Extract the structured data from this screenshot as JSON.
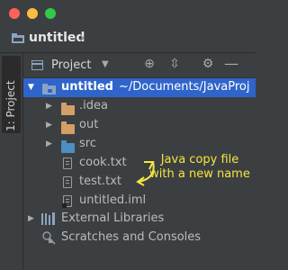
{
  "window": {
    "title": "untitled"
  },
  "sidebar": {
    "tab_label": "1: Project"
  },
  "panel": {
    "view_selector": "Project"
  },
  "tree": {
    "root_name": "untitled",
    "root_path": "~/Documents/JavaProj",
    "items": [
      {
        "label": ".idea",
        "kind": "folder",
        "color": "#d39f66"
      },
      {
        "label": "out",
        "kind": "folder",
        "color": "#d39f66"
      },
      {
        "label": "src",
        "kind": "folder",
        "color": "#4a90c2"
      },
      {
        "label": "cook.txt",
        "kind": "file"
      },
      {
        "label": "test.txt",
        "kind": "file"
      },
      {
        "label": "untitled.iml",
        "kind": "file"
      }
    ],
    "external_libraries": "External Libraries",
    "scratches": "Scratches and Consoles"
  },
  "annotation": {
    "text": "Java copy file with a new name",
    "color": "#f5e642"
  },
  "colors": {
    "selection": "#2f65ca",
    "background": "#3c3f41"
  }
}
